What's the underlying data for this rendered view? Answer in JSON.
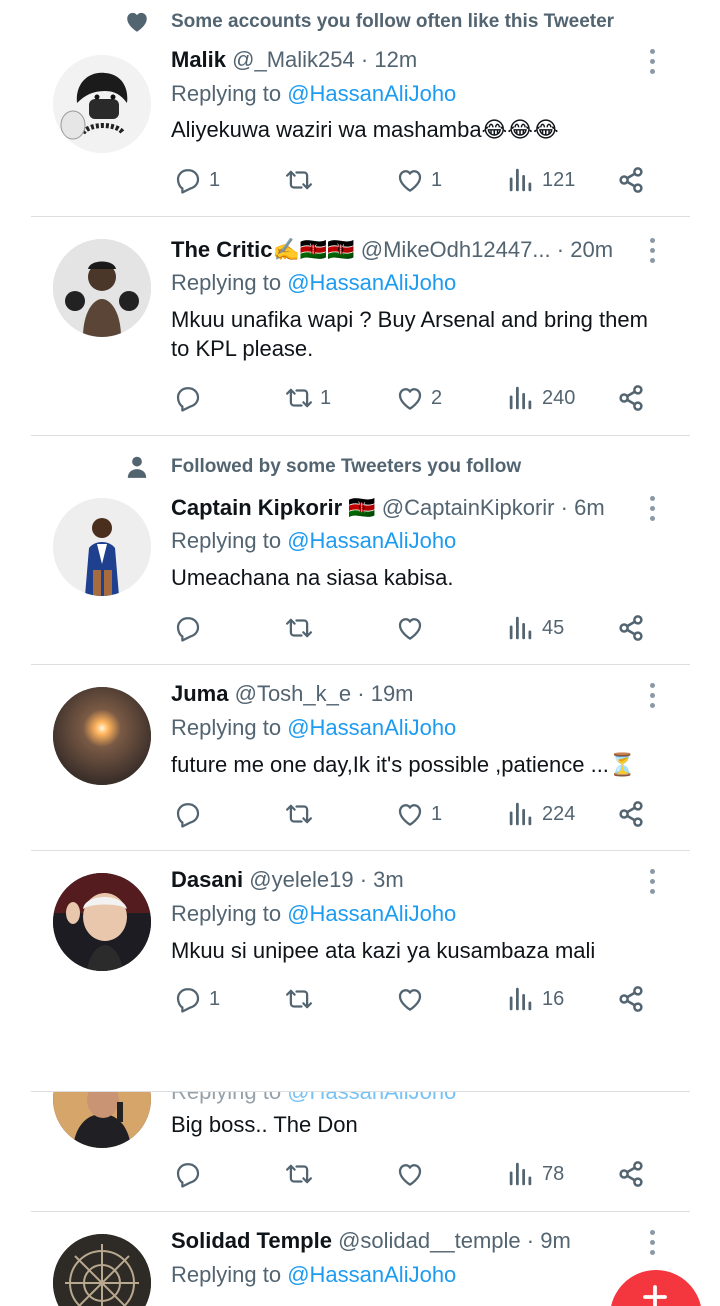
{
  "colors": {
    "accent": "#1d9bf0",
    "muted": "#536471",
    "text": "#0f1419",
    "fab": "#f4363f"
  },
  "tweets": [
    {
      "social_icon": "heart-icon",
      "social_text": "Some accounts you follow often like this Tweeter",
      "name": "Malik",
      "handle": "@_Malik254",
      "dot": "·",
      "time": "12m",
      "replying_prefix": "Replying to",
      "mention": "@HassanAliJoho",
      "text": "Aliyekuwa waziri wa mashamba😂😂😂",
      "replies": "1",
      "retweets": "",
      "likes": "1",
      "views": "121"
    },
    {
      "name": "The Critic✍️🇰🇪🇰🇪",
      "handle": "@MikeOdh12447...",
      "dot": "·",
      "time": "20m",
      "replying_prefix": "Replying to",
      "mention": "@HassanAliJoho",
      "text": "Mkuu unafika wapi ? Buy Arsenal and bring them to KPL please.",
      "replies": "",
      "retweets": "1",
      "likes": "2",
      "views": "240"
    },
    {
      "social_icon": "person-icon",
      "social_text": "Followed by some Tweeters you follow",
      "name": "Captain Kipkorir 🇰🇪",
      "handle": "@CaptainKipkorir",
      "dot": "·",
      "time": "6m",
      "replying_prefix": "Replying to",
      "mention": "@HassanAliJoho",
      "text": "Umeachana na siasa kabisa.",
      "replies": "",
      "retweets": "",
      "likes": "",
      "views": "45"
    },
    {
      "name": "Juma",
      "handle": "@Tosh_k_e",
      "dot": "·",
      "time": "19m",
      "replying_prefix": "Replying to",
      "mention": "@HassanAliJoho",
      "text": "future me one day,Ik it's possible ,patience ...⏳",
      "replies": "",
      "retweets": "",
      "likes": "1",
      "views": "224"
    },
    {
      "name": "Dasani",
      "handle": "@yelele19",
      "dot": "·",
      "time": "3m",
      "replying_prefix": "Replying to",
      "mention": "@HassanAliJoho",
      "text": "Mkuu si unipee ata kazi ya kusambaza mali",
      "replies": "1",
      "retweets": "",
      "likes": "",
      "views": "16"
    },
    {
      "replying_prefix": "Replying to",
      "mention": "@HassanAliJoho",
      "text": "Big boss.. The Don",
      "replies": "",
      "retweets": "",
      "likes": "",
      "views": "78"
    },
    {
      "name": "Solidad Temple",
      "handle": "@solidad__temple",
      "dot": "·",
      "time": "9m",
      "replying_prefix": "Replying to",
      "mention": "@HassanAliJoho"
    }
  ],
  "fab": {
    "icon": "compose-icon"
  }
}
